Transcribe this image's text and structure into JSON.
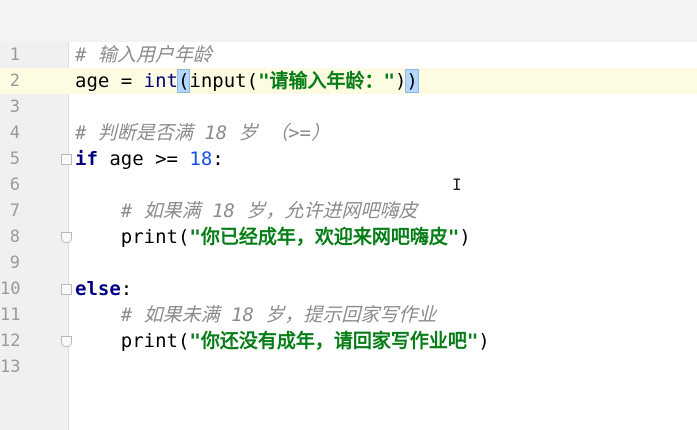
{
  "editor": {
    "lines": [
      {
        "num": "1",
        "parts": [
          {
            "t": "# 输入用户年龄",
            "c": "comment"
          }
        ]
      },
      {
        "num": "2",
        "current": true,
        "parts": [
          {
            "t": "age = ",
            "c": ""
          },
          {
            "t": "int",
            "c": "builtin"
          },
          {
            "t": "(",
            "c": "brace-hl"
          },
          {
            "t": "input(",
            "c": ""
          },
          {
            "t": "\"请输入年龄：\"",
            "c": "str"
          },
          {
            "t": ")",
            "c": ""
          },
          {
            "t": ")",
            "c": "brace-hl"
          }
        ]
      },
      {
        "num": "3",
        "parts": []
      },
      {
        "num": "4",
        "parts": [
          {
            "t": "# 判断是否满 18 岁 （>=）",
            "c": "comment"
          }
        ]
      },
      {
        "num": "5",
        "fold": "open",
        "parts": [
          {
            "t": "if",
            "c": "kw"
          },
          {
            "t": " age >= ",
            "c": ""
          },
          {
            "t": "18",
            "c": "num"
          },
          {
            "t": ":",
            "c": ""
          }
        ]
      },
      {
        "num": "6",
        "parts": []
      },
      {
        "num": "7",
        "parts": [
          {
            "t": "    # 如果满 18 岁，允许进网吧嗨皮",
            "c": "comment"
          }
        ]
      },
      {
        "num": "8",
        "fold": "end",
        "parts": [
          {
            "t": "    print(",
            "c": ""
          },
          {
            "t": "\"你已经成年，欢迎来网吧嗨皮\"",
            "c": "str"
          },
          {
            "t": ")",
            "c": ""
          }
        ]
      },
      {
        "num": "9",
        "parts": []
      },
      {
        "num": "10",
        "fold": "open",
        "parts": [
          {
            "t": "else",
            "c": "kw"
          },
          {
            "t": ":",
            "c": ""
          }
        ]
      },
      {
        "num": "11",
        "parts": [
          {
            "t": "    # 如果未满 18 岁，提示回家写作业",
            "c": "comment"
          }
        ]
      },
      {
        "num": "12",
        "fold": "end",
        "parts": [
          {
            "t": "    print(",
            "c": ""
          },
          {
            "t": "\"你还没有成年，请回家写作业吧\"",
            "c": "str"
          },
          {
            "t": ")",
            "c": ""
          }
        ]
      },
      {
        "num": "13",
        "parts": []
      }
    ]
  },
  "colors": {
    "current_line": "#fdfce3",
    "keyword": "#000080",
    "string": "#067d17",
    "number": "#1750eb",
    "comment": "#8c8c8c",
    "brace_highlight": "#b4d7ff"
  },
  "icons": {
    "mouse_cursor": "text-cursor-icon",
    "fold_marker": "fold-marker-icon"
  }
}
